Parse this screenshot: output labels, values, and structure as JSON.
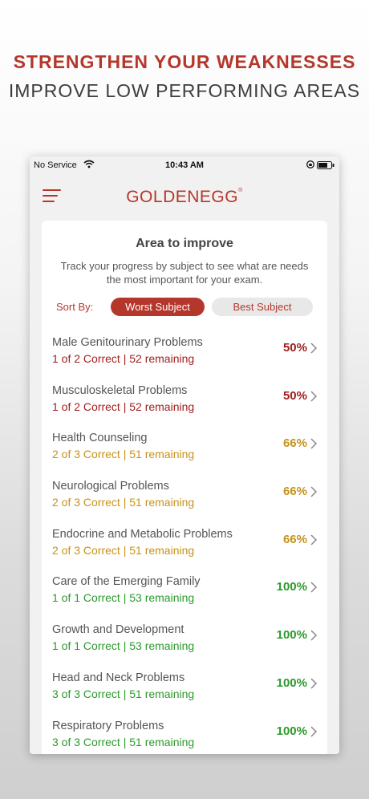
{
  "promo": {
    "headline": "STRENGTHEN YOUR WEAKNESSES",
    "subheadline": "IMPROVE LOW PERFORMING AREAS"
  },
  "status_bar": {
    "carrier": "No Service",
    "time": "10:43 AM",
    "icons": [
      "wifi-icon",
      "rotation-lock-icon",
      "battery-icon"
    ]
  },
  "nav": {
    "logo": "GOLDENEGG",
    "logo_mark": "®",
    "menu_icon": "hamburger-menu-icon"
  },
  "card": {
    "title": "Area to improve",
    "description": "Track your progress by subject to see what are needs the most important for your exam.",
    "sort_label": "Sort By:",
    "sort_options": [
      "Worst Subject",
      "Best Subject"
    ],
    "selected_sort": "Worst Subject"
  },
  "subjects": [
    {
      "name": "Male Genitourinary Problems",
      "stats": "1 of 2  Correct | 52 remaining",
      "percent": "50%",
      "level": "red"
    },
    {
      "name": "Musculoskeletal Problems",
      "stats": "1 of 2  Correct | 52 remaining",
      "percent": "50%",
      "level": "red"
    },
    {
      "name": "Health Counseling",
      "stats": "2 of 3  Correct | 51 remaining",
      "percent": "66%",
      "level": "gold"
    },
    {
      "name": "Neurological Problems",
      "stats": "2 of 3  Correct | 51 remaining",
      "percent": "66%",
      "level": "gold"
    },
    {
      "name": "Endocrine and Metabolic Problems",
      "stats": "2 of 3  Correct | 51 remaining",
      "percent": "66%",
      "level": "gold"
    },
    {
      "name": "Care of the Emerging Family",
      "stats": "1 of 1  Correct | 53 remaining",
      "percent": "100%",
      "level": "green"
    },
    {
      "name": "Growth and Development",
      "stats": "1 of 1  Correct | 53 remaining",
      "percent": "100%",
      "level": "green"
    },
    {
      "name": "Head and Neck Problems",
      "stats": "3 of 3  Correct | 51 remaining",
      "percent": "100%",
      "level": "green"
    },
    {
      "name": "Respiratory Problems",
      "stats": "3 of 3  Correct | 51 remaining",
      "percent": "100%",
      "level": "green"
    }
  ],
  "colors": {
    "brand": "#b5372b",
    "low": "#a21e1e",
    "mid": "#c7921a",
    "high": "#2b9a2b"
  }
}
